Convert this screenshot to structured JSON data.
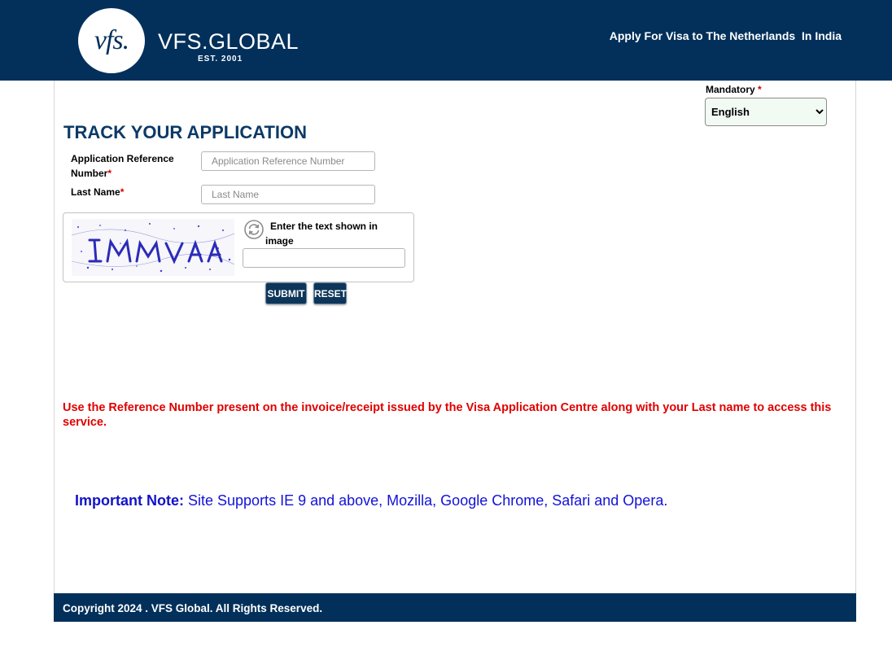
{
  "header": {
    "logo_text": "vfs.",
    "brand_name": "VFS.GLOBAL",
    "brand_est": "EST. 2001",
    "tagline": "Apply For Visa to The Netherlands  In India"
  },
  "language": {
    "label": "Mandatory",
    "required_mark": "*",
    "selected": "English"
  },
  "form": {
    "title": "TRACK YOUR APPLICATION",
    "reference_label": "Application Reference Number",
    "reference_placeholder": "Application Reference Number",
    "lastname_label": "Last Name",
    "lastname_placeholder": "Last Name",
    "required_mark": "*",
    "captcha_label": "Enter the text shown in image",
    "captcha_value": "",
    "submit_label": "SUBMIT",
    "reset_label": "RESET"
  },
  "instruction": "Use the Reference Number present on the invoice/receipt issued by the Visa Application Centre along with your Last name to access this service.",
  "note": {
    "label": "Important Note:",
    "text": " Site Supports IE 9 and above, Mozilla, Google Chrome, Safari and Opera."
  },
  "footer": {
    "copyright": "Copyright 2024 . VFS Global. All Rights Reserved."
  },
  "colors": {
    "brand_navy": "#02305a",
    "title_blue": "#0d3a66",
    "alert_red": "#e10000",
    "note_blue": "#1212d8",
    "button_navy": "#0d3559"
  },
  "icons": {
    "refresh": "refresh-icon",
    "captcha": "captcha-image"
  }
}
